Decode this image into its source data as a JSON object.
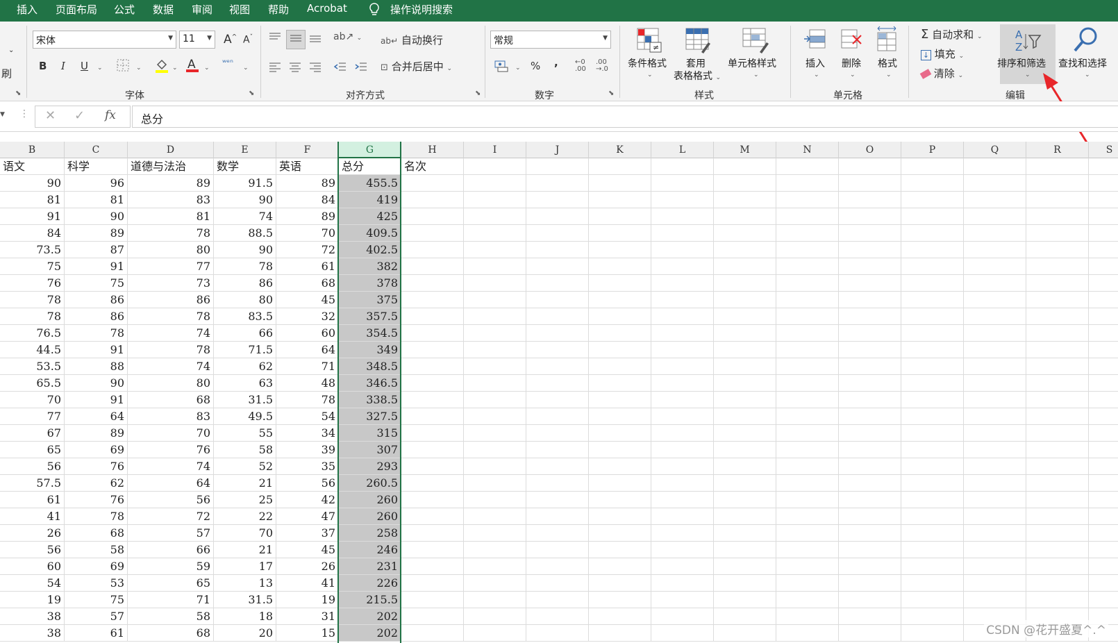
{
  "menu": {
    "items": [
      "插入",
      "页面布局",
      "公式",
      "数据",
      "审阅",
      "视图",
      "帮助",
      "Acrobat"
    ],
    "tell_me": "操作说明搜索"
  },
  "ribbon": {
    "clipboard": {
      "format_painter_partial": "刷"
    },
    "font": {
      "font_name": "宋体",
      "font_size": "11",
      "grow": "A",
      "shrink": "A",
      "bold": "B",
      "italic": "I",
      "underline": "U",
      "group_label": "字体"
    },
    "alignment": {
      "wrap_text": "自动换行",
      "merge_center": "合并后居中",
      "group_label": "对齐方式"
    },
    "number": {
      "format": "常规",
      "percent": "%",
      "comma": ",",
      "group_label": "数字"
    },
    "styles": {
      "conditional": "条件格式",
      "table_line1": "套用",
      "table_line2": "表格格式",
      "cell_styles": "单元格样式",
      "group_label": "样式"
    },
    "cells": {
      "insert": "插入",
      "delete": "删除",
      "format": "格式",
      "group_label": "单元格"
    },
    "editing": {
      "autosum": "自动求和",
      "fill": "填充",
      "clear": "清除",
      "sort_filter": "排序和筛选",
      "find_select": "查找和选择",
      "group_label": "编辑"
    }
  },
  "formula_bar": {
    "cancel": "✕",
    "enter": "✓",
    "fx": "fx",
    "content": "总分"
  },
  "grid": {
    "columns": [
      "B",
      "C",
      "D",
      "E",
      "F",
      "G",
      "H",
      "I",
      "J",
      "K",
      "L",
      "M",
      "N",
      "O",
      "P",
      "Q",
      "R",
      "S"
    ],
    "selected_column": "G",
    "header_row": [
      "语文",
      "科学",
      "道德与法治",
      "数学",
      "英语",
      "总分",
      "名次"
    ],
    "rows": [
      [
        "90",
        "96",
        "89",
        "91.5",
        "89",
        "455.5"
      ],
      [
        "81",
        "81",
        "83",
        "90",
        "84",
        "419"
      ],
      [
        "91",
        "90",
        "81",
        "74",
        "89",
        "425"
      ],
      [
        "84",
        "89",
        "78",
        "88.5",
        "70",
        "409.5"
      ],
      [
        "73.5",
        "87",
        "80",
        "90",
        "72",
        "402.5"
      ],
      [
        "75",
        "91",
        "77",
        "78",
        "61",
        "382"
      ],
      [
        "76",
        "75",
        "73",
        "86",
        "68",
        "378"
      ],
      [
        "78",
        "86",
        "86",
        "80",
        "45",
        "375"
      ],
      [
        "78",
        "86",
        "78",
        "83.5",
        "32",
        "357.5"
      ],
      [
        "76.5",
        "78",
        "74",
        "66",
        "60",
        "354.5"
      ],
      [
        "44.5",
        "91",
        "78",
        "71.5",
        "64",
        "349"
      ],
      [
        "53.5",
        "88",
        "74",
        "62",
        "71",
        "348.5"
      ],
      [
        "65.5",
        "90",
        "80",
        "63",
        "48",
        "346.5"
      ],
      [
        "70",
        "91",
        "68",
        "31.5",
        "78",
        "338.5"
      ],
      [
        "77",
        "64",
        "83",
        "49.5",
        "54",
        "327.5"
      ],
      [
        "67",
        "89",
        "70",
        "55",
        "34",
        "315"
      ],
      [
        "65",
        "69",
        "76",
        "58",
        "39",
        "307"
      ],
      [
        "56",
        "76",
        "74",
        "52",
        "35",
        "293"
      ],
      [
        "57.5",
        "62",
        "64",
        "21",
        "56",
        "260.5"
      ],
      [
        "61",
        "76",
        "56",
        "25",
        "42",
        "260"
      ],
      [
        "41",
        "78",
        "72",
        "22",
        "47",
        "260"
      ],
      [
        "26",
        "68",
        "57",
        "70",
        "37",
        "258"
      ],
      [
        "56",
        "58",
        "66",
        "21",
        "45",
        "246"
      ],
      [
        "60",
        "69",
        "59",
        "17",
        "26",
        "231"
      ],
      [
        "54",
        "53",
        "65",
        "13",
        "41",
        "226"
      ],
      [
        "19",
        "75",
        "71",
        "31.5",
        "19",
        "215.5"
      ],
      [
        "38",
        "57",
        "58",
        "18",
        "31",
        "202"
      ],
      [
        "38",
        "61",
        "68",
        "20",
        "15",
        "202"
      ]
    ]
  },
  "watermark": "CSDN @花开盛夏^.^",
  "colors": {
    "accent": "#217346",
    "selection_fill": "#c8c8c8",
    "arrow": "#e8262a"
  }
}
